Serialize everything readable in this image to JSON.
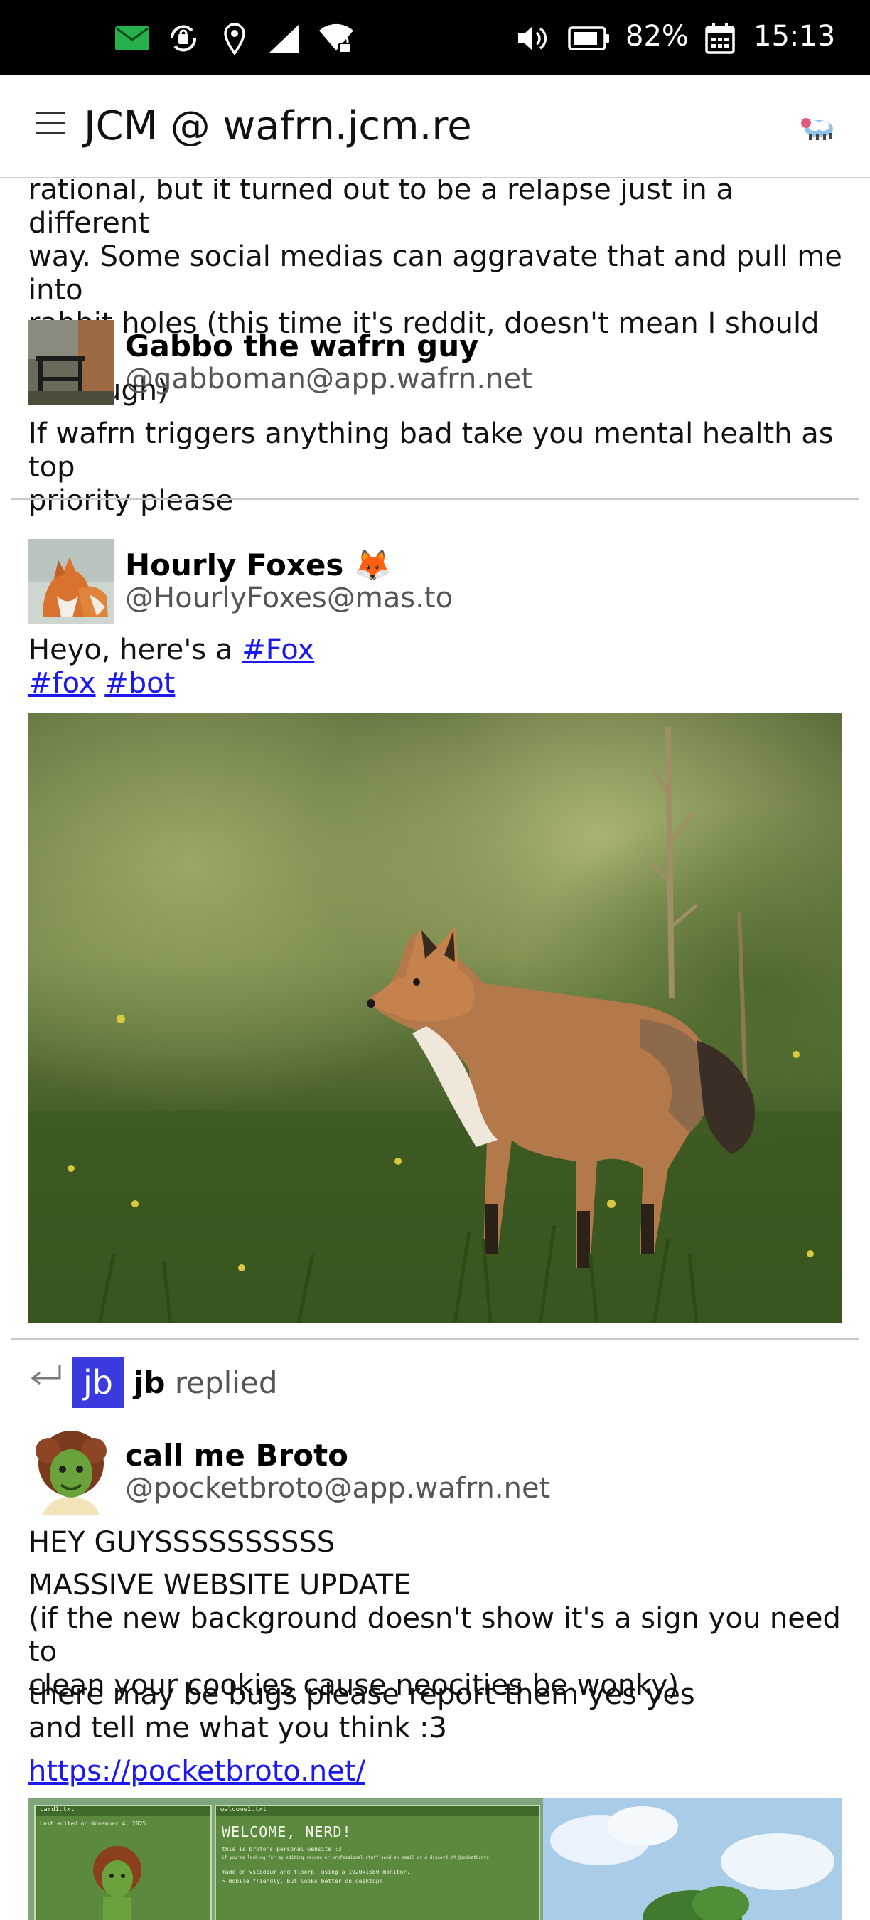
{
  "status_bar": {
    "battery_percent": "82%",
    "time": "15:13",
    "icons": [
      "mail-icon",
      "sync-icon",
      "location-icon",
      "signal-icon",
      "wifi-icon",
      "volume-icon",
      "battery-icon",
      "calendar-icon"
    ]
  },
  "header": {
    "title": "JCM @ wafrn.jcm.re",
    "menu_icon": "hamburger-menu-icon",
    "logo_icon": "wafrn-logo-icon"
  },
  "posts": [
    {
      "text_lines": [
        "rational, but it turned out to be a relapse just in a different",
        "way. Some social medias can aggravate that and pull me into",
        "rabbit holes (this time it's reddit, doesn't mean I should avoid",
        "it though)"
      ]
    },
    {
      "author_name": "Gabbo the wafrn guy",
      "author_handle": "@gabboman@app.wafrn.net",
      "text_lines": [
        "If wafrn triggers anything bad take you mental health as top",
        "priority please"
      ]
    },
    {
      "author_name": "Hourly Foxes",
      "author_emoji": "🦊",
      "author_handle": "@HourlyFoxes@mas.to",
      "text_prefix": "Heyo, here's a ",
      "tags": [
        "#Fox",
        "#fox",
        "#bot"
      ]
    },
    {
      "reply_user_initials": "jb",
      "reply_user": "jb",
      "reply_action": "replied",
      "author_name": "call me Broto",
      "author_handle": "@pocketbroto@app.wafrn.net",
      "line1": "HEY GUYSSSSSSSSSS",
      "para2": [
        "MASSIVE WEBSITE UPDATE",
        "(if the new background doesn't show it's a sign you need to",
        "clean your cookies cause neocities be wonky)"
      ],
      "para3": [
        "there may be bugs please report them yes yes",
        "and tell me what you think :3"
      ],
      "link": "https://pocketbroto.net/",
      "preview": {
        "left_tab": "card1.txt",
        "left_caption": "Last edited on November 4, 2025",
        "mid_tab": "welcome1.txt",
        "mid_title": "WELCOME, NERD!",
        "mid_lines": [
          "this is broto's personal website :3",
          "if you're looking for my editing resume or professional stuff send an email or a discord DM @pocketbroto",
          "made on vscodium and floorp, using a 1920x1080 monitor.",
          "> mobile friendly, but looks better on desktop!"
        ]
      }
    }
  ]
}
